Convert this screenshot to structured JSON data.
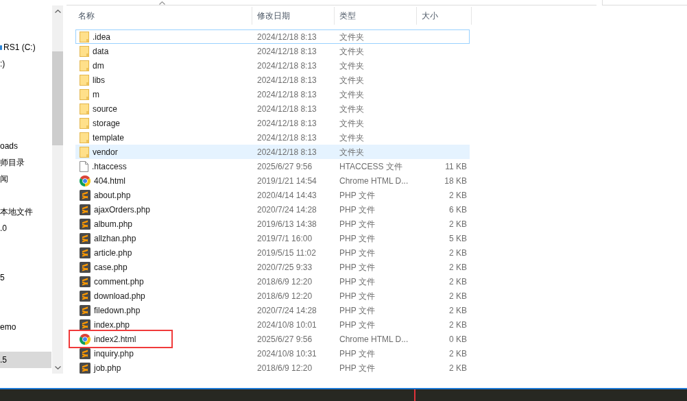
{
  "nav_pane": {
    "items": [
      {
        "label": "RS1 (C:)",
        "kind": "drive",
        "selected": false
      },
      {
        "label": ":)",
        "kind": "plain",
        "selected": false
      },
      {
        "label": "oads",
        "kind": "plain",
        "selected": false
      },
      {
        "label": "师目录",
        "kind": "plain",
        "selected": false
      },
      {
        "label": "闻",
        "kind": "plain",
        "selected": false
      },
      {
        "label": "本地文件",
        "kind": "plain",
        "selected": false
      },
      {
        "label": ".0",
        "kind": "plain",
        "selected": false
      },
      {
        "label": "5",
        "kind": "plain",
        "selected": false
      },
      {
        "label": "emo",
        "kind": "plain",
        "selected": false
      },
      {
        "label": ".5",
        "kind": "plain",
        "selected": true
      }
    ]
  },
  "file_list": {
    "columns": [
      {
        "label": "名称",
        "sorted": true
      },
      {
        "label": "修改日期",
        "sorted": false
      },
      {
        "label": "类型",
        "sorted": false
      },
      {
        "label": "大小",
        "sorted": false
      }
    ],
    "rows": [
      {
        "name": ".idea",
        "kind": "folder",
        "modified": "2024/12/18 8:13",
        "type": "文件夹",
        "selected": false,
        "focused": true,
        "hovered": false,
        "annotated": false
      },
      {
        "name": "data",
        "kind": "folder",
        "modified": "2024/12/18 8:13",
        "type": "文件夹",
        "selected": false,
        "focused": false,
        "hovered": false,
        "annotated": false
      },
      {
        "name": "dm",
        "kind": "folder",
        "modified": "2024/12/18 8:13",
        "type": "文件夹",
        "selected": false,
        "focused": false,
        "hovered": false,
        "annotated": false
      },
      {
        "name": "libs",
        "kind": "folder",
        "modified": "2024/12/18 8:13",
        "type": "文件夹",
        "selected": false,
        "focused": false,
        "hovered": false,
        "annotated": false
      },
      {
        "name": "m",
        "kind": "folder",
        "modified": "2024/12/18 8:13",
        "type": "文件夹",
        "selected": false,
        "focused": false,
        "hovered": false,
        "annotated": false
      },
      {
        "name": "source",
        "kind": "folder",
        "modified": "2024/12/18 8:13",
        "type": "文件夹",
        "selected": false,
        "focused": false,
        "hovered": false,
        "annotated": false
      },
      {
        "name": "storage",
        "kind": "folder",
        "modified": "2024/12/18 8:13",
        "type": "文件夹",
        "selected": false,
        "focused": false,
        "hovered": false,
        "annotated": false
      },
      {
        "name": "template",
        "kind": "folder",
        "modified": "2024/12/18 8:13",
        "type": "文件夹",
        "selected": false,
        "focused": false,
        "hovered": false,
        "annotated": false
      },
      {
        "name": "vendor",
        "kind": "folder",
        "modified": "2024/12/18 8:13",
        "type": "文件夹",
        "selected": false,
        "focused": false,
        "hovered": true,
        "annotated": false
      },
      {
        "name": ".htaccess",
        "kind": "file",
        "modified": "2025/6/27 9:56",
        "type": "HTACCESS 文件",
        "size": "11 KB",
        "selected": false,
        "focused": false,
        "hovered": false,
        "annotated": false
      },
      {
        "name": "404.html",
        "kind": "chrome",
        "modified": "2019/1/21 14:54",
        "type": "Chrome HTML D...",
        "size": "18 KB",
        "selected": false,
        "focused": false,
        "hovered": false,
        "annotated": false
      },
      {
        "name": "about.php",
        "kind": "php",
        "modified": "2020/4/14 14:43",
        "type": "PHP 文件",
        "size": "2 KB",
        "selected": false,
        "focused": false,
        "hovered": false,
        "annotated": false
      },
      {
        "name": "ajaxOrders.php",
        "kind": "php",
        "modified": "2020/7/24 14:28",
        "type": "PHP 文件",
        "size": "6 KB",
        "selected": false,
        "focused": false,
        "hovered": false,
        "annotated": false
      },
      {
        "name": "album.php",
        "kind": "php",
        "modified": "2019/6/13 14:38",
        "type": "PHP 文件",
        "size": "2 KB",
        "selected": false,
        "focused": false,
        "hovered": false,
        "annotated": false
      },
      {
        "name": "allzhan.php",
        "kind": "php",
        "modified": "2019/7/1 16:00",
        "type": "PHP 文件",
        "size": "5 KB",
        "selected": false,
        "focused": false,
        "hovered": false,
        "annotated": false
      },
      {
        "name": "article.php",
        "kind": "php",
        "modified": "2019/5/15 11:02",
        "type": "PHP 文件",
        "size": "2 KB",
        "selected": false,
        "focused": false,
        "hovered": false,
        "annotated": false
      },
      {
        "name": "case.php",
        "kind": "php",
        "modified": "2020/7/25 9:33",
        "type": "PHP 文件",
        "size": "2 KB",
        "selected": false,
        "focused": false,
        "hovered": false,
        "annotated": false
      },
      {
        "name": "comment.php",
        "kind": "php",
        "modified": "2018/6/9 12:20",
        "type": "PHP 文件",
        "size": "2 KB",
        "selected": false,
        "focused": false,
        "hovered": false,
        "annotated": false
      },
      {
        "name": "download.php",
        "kind": "php",
        "modified": "2018/6/9 12:20",
        "type": "PHP 文件",
        "size": "2 KB",
        "selected": false,
        "focused": false,
        "hovered": false,
        "annotated": false
      },
      {
        "name": "filedown.php",
        "kind": "php",
        "modified": "2020/7/24 14:28",
        "type": "PHP 文件",
        "size": "2 KB",
        "selected": false,
        "focused": false,
        "hovered": false,
        "annotated": false
      },
      {
        "name": "index.php",
        "kind": "php",
        "modified": "2024/10/8 10:01",
        "type": "PHP 文件",
        "size": "2 KB",
        "selected": false,
        "focused": false,
        "hovered": false,
        "annotated": false
      },
      {
        "name": "index2.html",
        "kind": "chrome",
        "modified": "2025/6/27 9:56",
        "type": "Chrome HTML D...",
        "size": "0 KB",
        "selected": false,
        "focused": false,
        "hovered": false,
        "annotated": true
      },
      {
        "name": "inquiry.php",
        "kind": "php",
        "modified": "2024/10/8 10:31",
        "type": "PHP 文件",
        "size": "2 KB",
        "selected": false,
        "focused": false,
        "hovered": false,
        "annotated": false
      },
      {
        "name": "job.php",
        "kind": "php",
        "modified": "2018/6/9 12:20",
        "type": "PHP 文件",
        "size": "2 KB",
        "selected": false,
        "focused": false,
        "hovered": false,
        "annotated": false
      }
    ]
  }
}
